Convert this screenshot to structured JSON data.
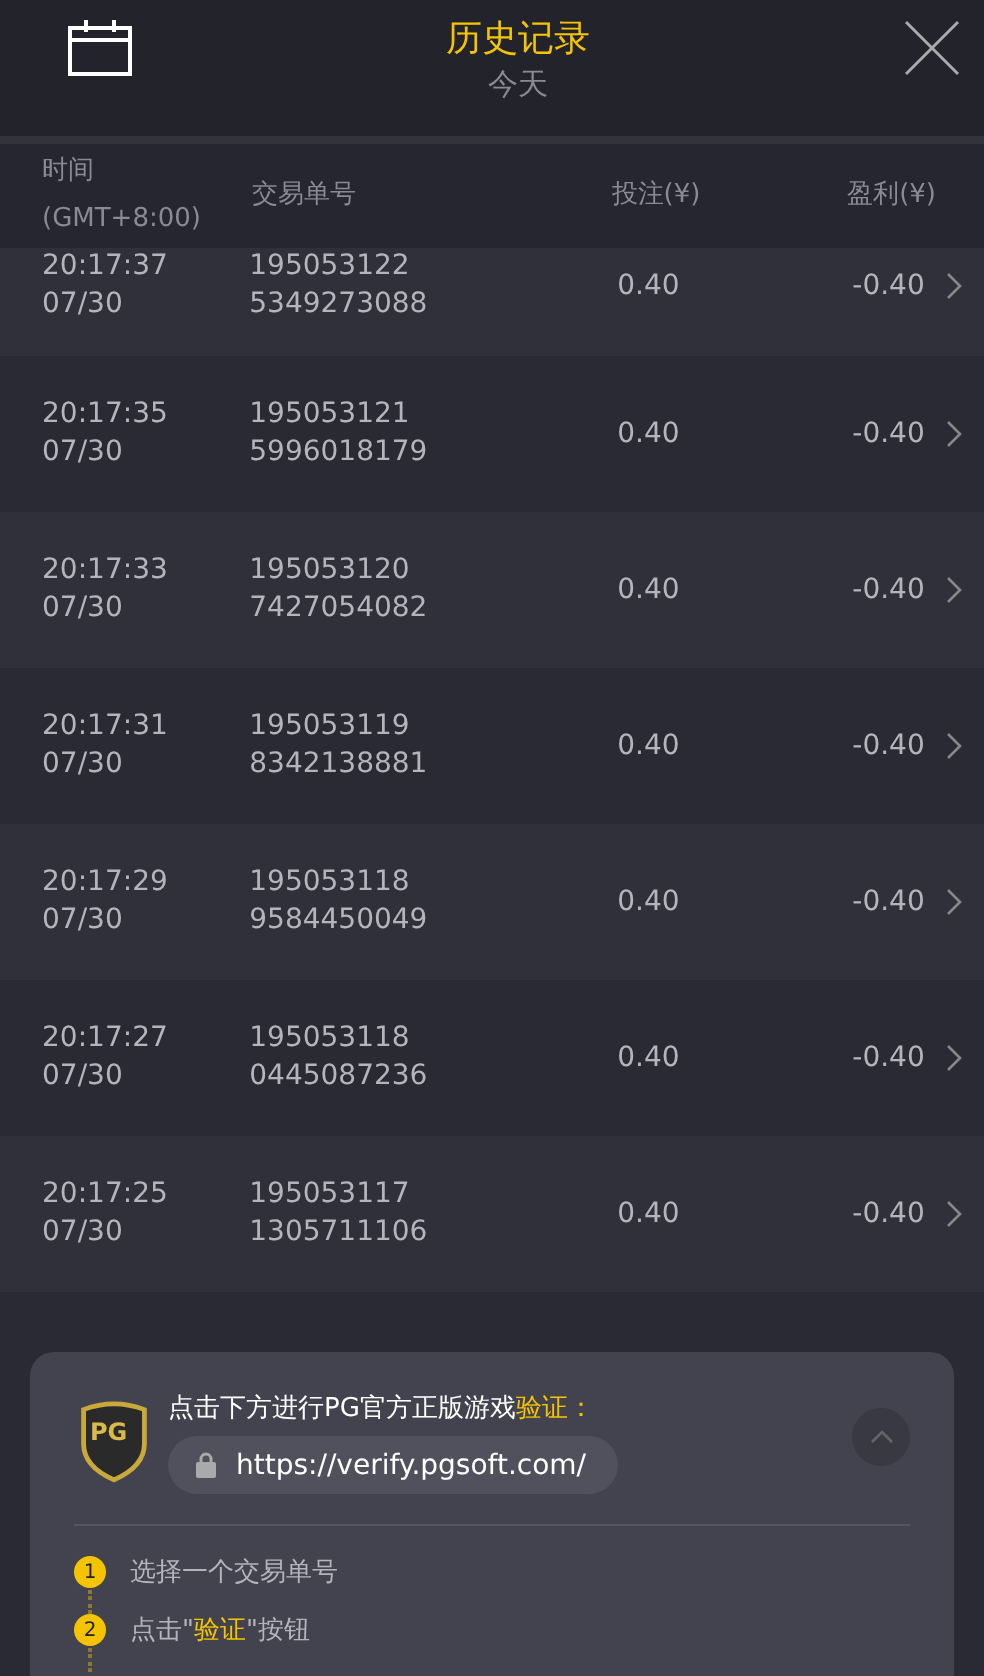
{
  "header": {
    "title": "历史记录",
    "subtitle": "今天"
  },
  "table": {
    "columns": [
      {
        "line1": "时间",
        "line2": "(GMT+8:00)"
      },
      {
        "line1": "交易单号"
      },
      {
        "line1": "投注(¥)"
      },
      {
        "line1": "盈利(¥)"
      }
    ],
    "rows": [
      {
        "time": "20:17:37",
        "date": "07/30",
        "id1": "195053122",
        "id2": "5349273088",
        "bet": "0.40",
        "profit": "-0.40"
      },
      {
        "time": "20:17:35",
        "date": "07/30",
        "id1": "195053121",
        "id2": "5996018179",
        "bet": "0.40",
        "profit": "-0.40"
      },
      {
        "time": "20:17:33",
        "date": "07/30",
        "id1": "195053120",
        "id2": "7427054082",
        "bet": "0.40",
        "profit": "-0.40"
      },
      {
        "time": "20:17:31",
        "date": "07/30",
        "id1": "195053119",
        "id2": "8342138881",
        "bet": "0.40",
        "profit": "-0.40"
      },
      {
        "time": "20:17:29",
        "date": "07/30",
        "id1": "195053118",
        "id2": "9584450049",
        "bet": "0.40",
        "profit": "-0.40"
      },
      {
        "time": "20:17:27",
        "date": "07/30",
        "id1": "195053118",
        "id2": "0445087236",
        "bet": "0.40",
        "profit": "-0.40"
      },
      {
        "time": "20:17:25",
        "date": "07/30",
        "id1": "195053117",
        "id2": "1305711106",
        "bet": "0.40",
        "profit": "-0.40"
      }
    ]
  },
  "verify_panel": {
    "logo": "PG",
    "message": [
      {
        "text": "点击下方进行PG官方正版游戏",
        "highlight": false
      },
      {
        "text": "验证：",
        "highlight": true
      }
    ],
    "url": "https://verify.pgsoft.com/",
    "steps": [
      {
        "number": "1",
        "parts": [
          {
            "text": "选择一个交易单号",
            "highlight": false
          }
        ]
      },
      {
        "number": "2",
        "parts": [
          {
            "text": "点击\"",
            "highlight": false
          },
          {
            "text": "验证",
            "highlight": true
          },
          {
            "text": "\"按钮",
            "highlight": false
          }
        ]
      }
    ]
  }
}
